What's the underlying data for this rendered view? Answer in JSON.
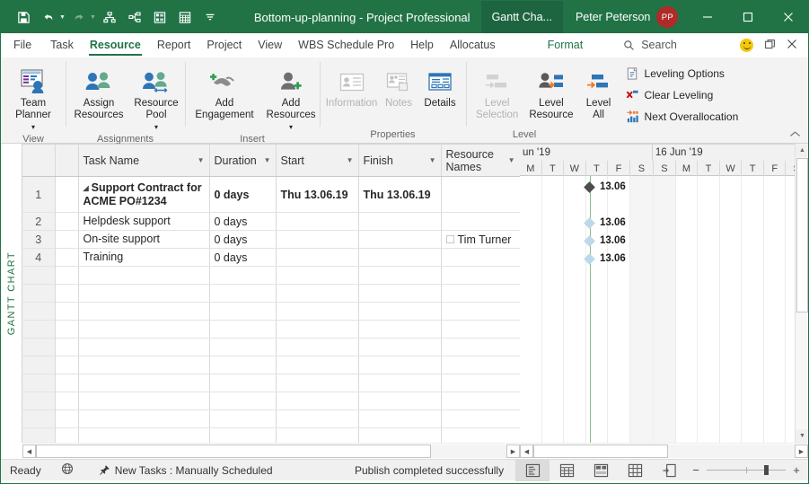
{
  "titlebar": {
    "quick_access": [
      {
        "name": "save-icon",
        "label": "Save"
      },
      {
        "name": "undo-icon",
        "label": "Undo"
      },
      {
        "name": "redo-icon",
        "label": "Redo"
      },
      {
        "name": "wbs-chart-icon",
        "label": "WBS Chart"
      },
      {
        "name": "network-diagram-icon",
        "label": "Network Diagram"
      },
      {
        "name": "task-form-icon",
        "label": "Task Form"
      },
      {
        "name": "table-icon",
        "label": "Table"
      },
      {
        "name": "customize-qat-icon",
        "label": "Customize Quick Access Toolbar"
      }
    ],
    "document_title": "Bottom-up-planning",
    "separator": "-",
    "app_name": "Project Professional",
    "context_tab": "Gantt Cha...",
    "user_name": "Peter Peterson",
    "user_initials": "PP",
    "window_controls": [
      "minimize",
      "maximize",
      "close"
    ],
    "bg_color": "#217346"
  },
  "ribbon_tabs": {
    "items": [
      {
        "label": "File",
        "active": false
      },
      {
        "label": "Task",
        "active": false
      },
      {
        "label": "Resource",
        "active": true
      },
      {
        "label": "Report",
        "active": false
      },
      {
        "label": "Project",
        "active": false
      },
      {
        "label": "View",
        "active": false
      },
      {
        "label": "WBS Schedule Pro",
        "active": false
      },
      {
        "label": "Help",
        "active": false
      },
      {
        "label": "Allocatus",
        "active": false
      }
    ],
    "contextual": "Format",
    "search_placeholder": "Search",
    "accent_color": "#217346"
  },
  "ribbon": {
    "groups": [
      {
        "label": "View",
        "buttons": [
          {
            "label": "Team\nPlanner",
            "icon": "team-planner-icon",
            "dropdown": true,
            "disabled": false
          }
        ]
      },
      {
        "label": "Assignments",
        "buttons": [
          {
            "label": "Assign\nResources",
            "icon": "assign-resources-icon",
            "dropdown": false,
            "disabled": false
          },
          {
            "label": "Resource\nPool",
            "icon": "resource-pool-icon",
            "dropdown": true,
            "disabled": false
          }
        ]
      },
      {
        "label": "Insert",
        "buttons": [
          {
            "label": "Add\nEngagement",
            "icon": "add-engagement-icon",
            "dropdown": false,
            "disabled": false
          },
          {
            "label": "Add\nResources",
            "icon": "add-resources-icon",
            "dropdown": true,
            "disabled": false
          }
        ]
      },
      {
        "label": "Properties",
        "buttons": [
          {
            "label": "Information",
            "icon": "information-icon",
            "dropdown": false,
            "disabled": true
          },
          {
            "label": "Notes",
            "icon": "notes-icon",
            "dropdown": false,
            "disabled": true
          },
          {
            "label": "Details",
            "icon": "details-icon",
            "dropdown": false,
            "disabled": false
          }
        ]
      },
      {
        "label": "Level",
        "buttons": [
          {
            "label": "Level\nSelection",
            "icon": "level-selection-icon",
            "dropdown": false,
            "disabled": true
          },
          {
            "label": "Level\nResource",
            "icon": "level-resource-icon",
            "dropdown": false,
            "disabled": false
          },
          {
            "label": "Level\nAll",
            "icon": "level-all-icon",
            "dropdown": false,
            "disabled": false
          }
        ],
        "small_buttons": [
          {
            "label": "Leveling Options",
            "icon": "leveling-options-icon"
          },
          {
            "label": "Clear Leveling",
            "icon": "clear-leveling-icon"
          },
          {
            "label": "Next Overallocation",
            "icon": "next-overallocation-icon"
          }
        ]
      }
    ],
    "collapse_icon": "chevron-up-icon"
  },
  "view_label": "GANTT CHART",
  "grid": {
    "columns": [
      {
        "key": "name",
        "label": "Task Name"
      },
      {
        "key": "duration",
        "label": "Duration"
      },
      {
        "key": "start",
        "label": "Start"
      },
      {
        "key": "finish",
        "label": "Finish"
      },
      {
        "key": "resources",
        "label": "Resource\nNames"
      }
    ],
    "rows": [
      {
        "id": "1",
        "name": "Support Contract for ACME PO#1234",
        "duration": "0 days",
        "start": "Thu 13.06.19",
        "finish": "Thu 13.06.19",
        "resources": "",
        "summary": true,
        "indent": 0,
        "collapse_icon": "triangle-down-icon"
      },
      {
        "id": "2",
        "name": "Helpdesk support",
        "duration": "0 days",
        "start": "",
        "finish": "",
        "resources": "",
        "summary": false,
        "indent": 1
      },
      {
        "id": "3",
        "name": "On-site support",
        "duration": "0 days",
        "start": "",
        "finish": "",
        "resources": "Tim Turner",
        "resource_checkbox": true,
        "summary": false,
        "indent": 1
      },
      {
        "id": "4",
        "name": "Training",
        "duration": "0 days",
        "start": "",
        "finish": "",
        "resources": "",
        "summary": false,
        "indent": 1
      }
    ],
    "empty_row_count": 11
  },
  "chart": {
    "timeline": {
      "weeks": [
        {
          "label": "un '19",
          "days": [
            "M",
            "T",
            "W",
            "T",
            "F",
            "S"
          ],
          "weekend_index": [
            5
          ]
        },
        {
          "label": "16 Jun '19",
          "days": [
            "S",
            "M",
            "T",
            "W",
            "T",
            "F",
            "S"
          ],
          "weekend_index": [
            0
          ]
        }
      ]
    },
    "today_line_color": "#8bbf8b",
    "milestones": [
      {
        "row": 1,
        "label": "13.06",
        "color": "#4d4d4d",
        "kind": "summary-milestone"
      },
      {
        "row": 2,
        "label": "13.06",
        "color": "#bcd9ea",
        "kind": "milestone"
      },
      {
        "row": 3,
        "label": "13.06",
        "color": "#bcd9ea",
        "kind": "milestone"
      },
      {
        "row": 4,
        "label": "13.06",
        "color": "#bcd9ea",
        "kind": "milestone"
      }
    ]
  },
  "statusbar": {
    "ready": "Ready",
    "globe_icon": "globe-icon",
    "new_tasks_icon": "pin-icon",
    "new_tasks": "New Tasks : Manually Scheduled",
    "publish": "Publish completed successfully",
    "view_buttons": [
      {
        "name": "gantt-chart-view-button",
        "selected": true
      },
      {
        "name": "task-usage-view-button",
        "selected": false
      },
      {
        "name": "team-planner-view-button",
        "selected": false
      },
      {
        "name": "resource-sheet-view-button",
        "selected": false
      },
      {
        "name": "reports-view-button",
        "selected": false
      }
    ],
    "zoom_minus": "−",
    "zoom_plus": "+"
  }
}
